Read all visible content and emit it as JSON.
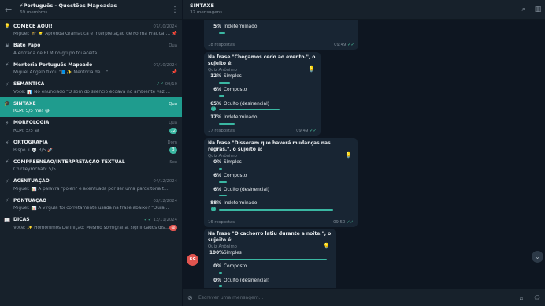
{
  "sidebar": {
    "title": "⚡Português - Questões Mapeadas",
    "subtitle": "69 membros",
    "chats": [
      {
        "icon": "💡",
        "name": "COMECE AQUI!",
        "time": "07/10/2024",
        "preview": "Miguel: 🎓 💡 Aprenda Gramática e Interpretação de Forma Prática! ...",
        "badge": "",
        "pin": "📌",
        "check": ""
      },
      {
        "icon": "#",
        "name": "Bate Papo",
        "time": "Qua",
        "preview": "A entrada de RLM no grupo foi aceita",
        "badge": "",
        "pin": "",
        "check": ""
      },
      {
        "icon": "⚡",
        "name": "Mentoria Português Mapeado",
        "time": "07/10/2024",
        "preview": "Miguel Ângelo fixou \"📘✨ Mentoria de ...\"",
        "badge": "",
        "pin": "📌",
        "check": ""
      },
      {
        "icon": "⚡",
        "name": "SEMÂNTICA",
        "time": "09/10",
        "preview": "Você: 📊 No enunciado \"O som do silêncio ecoava no ambiente vazio\", oco...",
        "badge": "",
        "pin": "",
        "check": "✓✓"
      },
      {
        "icon": "🎓",
        "name": "SINTAXE",
        "time": "Qua",
        "preview": "RLM: 5/5 me! 😅",
        "badge": "",
        "pin": "",
        "check": ""
      },
      {
        "icon": "⚡",
        "name": "MORFOLOGIA",
        "time": "Qua",
        "preview": "RLM: 5/5 😅",
        "badge": "12",
        "pin": "",
        "check": ""
      },
      {
        "icon": "⚡",
        "name": "ORTOGRAFIA",
        "time": "Dom",
        "preview": "Bispo ⚡ 💀 3/5 🚀",
        "badge": "3",
        "pin": "",
        "check": ""
      },
      {
        "icon": "⚡",
        "name": "COMPREENSÃO/INTERPRETAÇÃO TEXTUAL",
        "time": "Sex",
        "preview": "Chirlleyrochah: 5/5",
        "badge": "",
        "pin": "",
        "check": ""
      },
      {
        "icon": "⚡",
        "name": "ACENTUAÇÃO",
        "time": "04/12/2024",
        "preview": "Miguel: 📊 A palavra \"pólen\" é acentuada por ser uma paroxítona termina...",
        "badge": "",
        "pin": "",
        "check": ""
      },
      {
        "icon": "⚡",
        "name": "PONTUAÇÃO",
        "time": "02/12/2024",
        "preview": "Miguel: 📊 A vírgula foi corretamente usada na frase abaixo? \"Durante a vi...",
        "badge": "",
        "pin": "",
        "check": ""
      },
      {
        "icon": "📖",
        "name": "DICAS",
        "time": "13/11/2024",
        "preview": "Você: ✨ Homônimos  Definição: Mesmo som/grafia, significados distin...",
        "badge": "@",
        "pin": "",
        "check": "✓✓"
      }
    ]
  },
  "header": {
    "title": "SINTAXE",
    "subtitle": "32 mensagens"
  },
  "quizzes": [
    {
      "title": "",
      "kind": "",
      "options": [
        {
          "pct": "5%",
          "label": "Indeterminado",
          "frac": 0.05,
          "correct": false
        }
      ],
      "responses": "18 respostas",
      "time": "09:49"
    },
    {
      "title": "Na frase \"Chegamos cedo ao evento.\", o sujeito é:",
      "kind": "Quiz Anônimo",
      "options": [
        {
          "pct": "12%",
          "label": "Simples",
          "frac": 0.12,
          "correct": false
        },
        {
          "pct": "6%",
          "label": "Composto",
          "frac": 0.06,
          "correct": false
        },
        {
          "pct": "65%",
          "label": "Oculto (desinencial)",
          "frac": 0.65,
          "correct": true
        },
        {
          "pct": "17%",
          "label": "Indeterminado",
          "frac": 0.17,
          "correct": false
        }
      ],
      "responses": "17 respostas",
      "time": "09:49"
    },
    {
      "title": "Na frase \"Disseram que haverá mudanças nas regras.\", o sujeito é:",
      "kind": "Quiz Anônimo",
      "options": [
        {
          "pct": "0%",
          "label": "Simples",
          "frac": 0.0,
          "correct": false
        },
        {
          "pct": "6%",
          "label": "Composto",
          "frac": 0.06,
          "correct": false
        },
        {
          "pct": "6%",
          "label": "Oculto (desinencial)",
          "frac": 0.06,
          "correct": false
        },
        {
          "pct": "88%",
          "label": "Indeterminado",
          "frac": 0.88,
          "correct": true
        }
      ],
      "responses": "16 respostas",
      "time": "09:50"
    },
    {
      "title": "Na frase \"O cachorro latiu durante a noite.\", o sujeito é:",
      "kind": "Quiz Anônimo",
      "options": [
        {
          "pct": "100%",
          "label": "Simples",
          "frac": 1.0,
          "correct": false
        },
        {
          "pct": "0%",
          "label": "Composto",
          "frac": 0.0,
          "correct": false
        },
        {
          "pct": "0%",
          "label": "Oculto (desinencial)",
          "frac": 0.0,
          "correct": false
        }
      ],
      "responses": "",
      "time": ""
    }
  ],
  "avatar": {
    "initials": "SC"
  },
  "composer": {
    "placeholder": "Escrever uma mensagem..."
  },
  "icons": {
    "back": "arrow-left-icon",
    "menu": "more-vertical-icon",
    "search": "search-icon",
    "sidebar": "sidebar-toggle-icon",
    "attach": "paperclip-icon",
    "commands": "slash-icon",
    "emoji": "emoji-icon",
    "scroll": "chevron-down-icon",
    "hint": "lightbulb-icon"
  },
  "colors": {
    "accent": "#3ab7a2",
    "active_chat": "#1f9c8e",
    "bubble": "#182533",
    "background": "#0e1621"
  }
}
